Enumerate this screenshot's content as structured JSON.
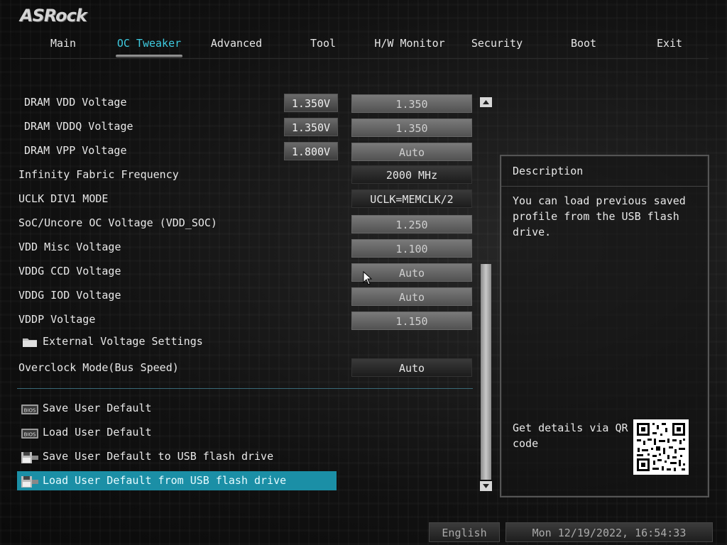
{
  "brand": "ASRock",
  "tabs": [
    {
      "label": "Main"
    },
    {
      "label": "OC Tweaker",
      "active": true
    },
    {
      "label": "Advanced"
    },
    {
      "label": "Tool"
    },
    {
      "label": "H/W Monitor"
    },
    {
      "label": "Security"
    },
    {
      "label": "Boot"
    },
    {
      "label": "Exit"
    }
  ],
  "settings": [
    {
      "label": "DRAM VDD Voltage",
      "current": "1.350V",
      "value": "1.350"
    },
    {
      "label": "DRAM VDDQ Voltage",
      "current": "1.350V",
      "value": "1.350"
    },
    {
      "label": "DRAM VPP Voltage",
      "current": "1.800V",
      "value": "Auto"
    },
    {
      "label": "Infinity Fabric Frequency",
      "value": "2000 MHz"
    },
    {
      "label": "UCLK DIV1 MODE",
      "value": "UCLK=MEMCLK/2"
    },
    {
      "label": "SoC/Uncore OC Voltage (VDD_SOC)",
      "value": "1.250"
    },
    {
      "label": "VDD Misc Voltage",
      "value": "1.100"
    },
    {
      "label": "VDDG CCD Voltage",
      "value": "Auto"
    },
    {
      "label": "VDDG IOD Voltage",
      "value": "Auto"
    },
    {
      "label": "VDDP Voltage",
      "value": "1.150"
    },
    {
      "label": "External Voltage Settings",
      "icon": "folder-icon"
    },
    {
      "label": "Overclock Mode(Bus Speed)",
      "value": "Auto"
    }
  ],
  "actions": [
    {
      "label": "Save User Default",
      "icon": "bios-icon"
    },
    {
      "label": "Load User Default",
      "icon": "bios-icon"
    },
    {
      "label": "Save User Default to USB flash drive",
      "icon": "floppy-disk-icon"
    },
    {
      "label": "Load User Default from USB flash drive",
      "icon": "floppy-disk-icon",
      "selected": true
    }
  ],
  "description": {
    "title": "Description",
    "text": "You can load previous saved\nprofile from the USB flash\ndrive.",
    "qr_text": "Get details via QR\ncode"
  },
  "footer": {
    "language": "English",
    "datetime": "Mon 12/19/2022, 16:54:33"
  },
  "colors": {
    "accent": "#3ecbe0",
    "selection": "#1b8fa6"
  }
}
